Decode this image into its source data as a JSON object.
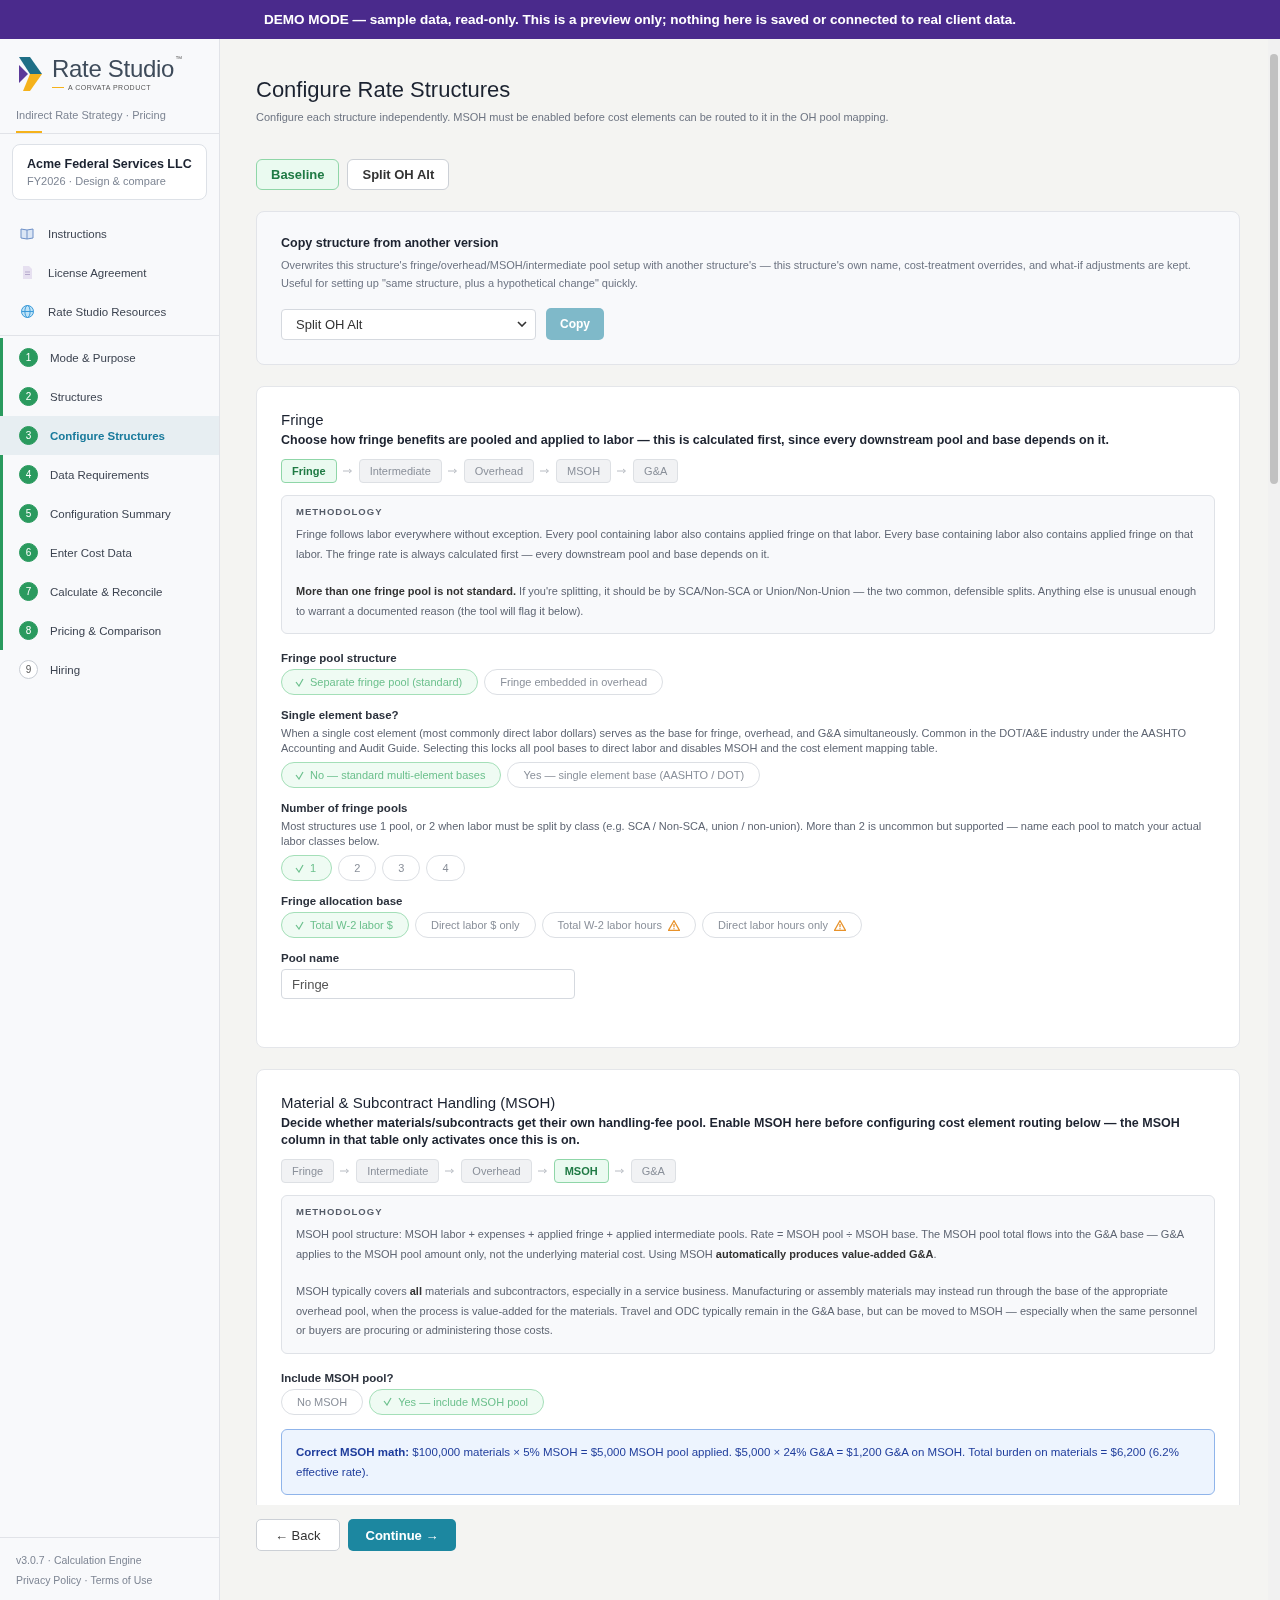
{
  "banner": {
    "text": "DEMO MODE — sample data, read-only. This is a preview only; nothing here is saved or connected to real client data."
  },
  "sidebar": {
    "logo": {
      "name": "Rate Studio",
      "trademark": "™",
      "tagline": "A CORVATA PRODUCT"
    },
    "subtitle": "Indirect Rate Strategy · Pricing",
    "client": {
      "name": "Acme Federal Services LLC",
      "detail": "FY2026 · Design & compare"
    },
    "links": [
      {
        "kind": "book",
        "label": "Instructions"
      },
      {
        "kind": "document",
        "label": "License Agreement"
      },
      {
        "kind": "globe",
        "label": "Rate Studio Resources"
      }
    ],
    "steps": [
      {
        "number": "1",
        "label": "Mode & Purpose",
        "completed": true,
        "selected": false
      },
      {
        "number": "2",
        "label": "Structures",
        "completed": true,
        "selected": false
      },
      {
        "number": "3",
        "label": "Configure Structures",
        "completed": true,
        "selected": true
      },
      {
        "number": "4",
        "label": "Data Requirements",
        "completed": true,
        "selected": false
      },
      {
        "number": "5",
        "label": "Configuration Summary",
        "completed": true,
        "selected": false
      },
      {
        "number": "6",
        "label": "Enter Cost Data",
        "completed": true,
        "selected": false
      },
      {
        "number": "7",
        "label": "Calculate & Reconcile",
        "completed": true,
        "selected": false
      },
      {
        "number": "8",
        "label": "Pricing & Comparison",
        "completed": true,
        "selected": false
      },
      {
        "number": "9",
        "label": "Hiring",
        "completed": false,
        "selected": false
      }
    ],
    "footer": {
      "version": "v3.0.7 · Calculation Engine",
      "links": [
        "Privacy Policy · Terms of Use"
      ]
    }
  },
  "page": {
    "title": "Configure Rate Structures",
    "subtitle": "Configure each structure independently. MSOH must be enabled before cost elements can be routed to it in the OH pool mapping."
  },
  "structure_tabs": [
    {
      "label": "Baseline",
      "selected": true
    },
    {
      "label": "Split OH Alt",
      "selected": false
    }
  ],
  "copy_panel": {
    "title": "Copy structure from another version",
    "description": "Overwrites this structure's fringe/overhead/MSOH/intermediate pool setup with another structure's — this structure's own name, cost-treatment overrides, and what-if adjustments are kept. Useful for setting up \"same structure, plus a hypothetical change\" quickly.",
    "select_value": "Split OH Alt",
    "button": "Copy"
  },
  "sections": [
    {
      "title": "Fringe",
      "lead": "Choose how fringe benefits are pooled and applied to labor — this is calculated first, since every downstream pool and base depends on it.",
      "pipeline": [
        {
          "label": "Fringe",
          "selected": true
        },
        {
          "label": "Intermediate",
          "selected": false
        },
        {
          "label": "Overhead",
          "selected": false
        },
        {
          "label": "MSOH",
          "selected": false
        },
        {
          "label": "G&A",
          "selected": false
        }
      ],
      "methodology": {
        "heading": "METHODOLOGY",
        "paragraphs": [
          "Fringe follows labor everywhere without exception. Every pool containing labor also contains applied fringe on that labor. Every base containing labor also contains applied fringe on that labor. The fringe rate is always calculated first — every downstream pool and base depends on it.",
          "**More than one fringe pool is not standard.** If you're splitting, it should be by SCA/Non-SCA or Union/Non-Union — the two common, defensible splits. Anything else is unusual enough to warrant a documented reason (the tool will flag it below)."
        ]
      },
      "fields": [
        {
          "kind": "options",
          "label": "Fringe pool structure",
          "options": [
            {
              "label": "Separate fringe pool (standard)",
              "selected": true,
              "warning": false
            },
            {
              "label": "Fringe embedded in overhead",
              "selected": false,
              "warning": false
            }
          ]
        },
        {
          "kind": "options",
          "label": "Single element base?",
          "help": "When a single cost element (most commonly direct labor dollars) serves as the base for fringe, overhead, and G&A simultaneously. Common in the DOT/A&E industry under the AASHTO Accounting and Audit Guide. Selecting this locks all pool bases to direct labor and disables MSOH and the cost element mapping table.",
          "options": [
            {
              "label": "No — standard multi-element bases",
              "selected": true,
              "warning": false
            },
            {
              "label": "Yes — single element base (AASHTO / DOT)",
              "selected": false,
              "warning": false
            }
          ]
        },
        {
          "kind": "options",
          "label": "Number of fringe pools",
          "help": "Most structures use 1 pool, or 2 when labor must be split by class (e.g. SCA / Non-SCA, union / non-union). More than 2 is uncommon but supported — name each pool to match your actual labor classes below.",
          "options": [
            {
              "label": "1",
              "selected": true,
              "warning": false
            },
            {
              "label": "2",
              "selected": false,
              "warning": false
            },
            {
              "label": "3",
              "selected": false,
              "warning": false
            },
            {
              "label": "4",
              "selected": false,
              "warning": false
            }
          ]
        },
        {
          "kind": "options",
          "label": "Fringe allocation base",
          "options": [
            {
              "label": "Total W-2 labor $",
              "selected": true,
              "warning": false
            },
            {
              "label": "Direct labor $ only",
              "selected": false,
              "warning": false
            },
            {
              "label": "Total W-2 labor hours",
              "selected": false,
              "warning": true
            },
            {
              "label": "Direct labor hours only",
              "selected": false,
              "warning": true
            }
          ]
        },
        {
          "kind": "text",
          "label": "Pool name",
          "value": "Fringe"
        }
      ]
    },
    {
      "title": "Material & Subcontract Handling (MSOH)",
      "lead": "Decide whether materials/subcontracts get their own handling-fee pool. Enable MSOH here **before** configuring cost element routing below — the MSOH column in that table only activates once this is on.",
      "pipeline": [
        {
          "label": "Fringe",
          "selected": false
        },
        {
          "label": "Intermediate",
          "selected": false
        },
        {
          "label": "Overhead",
          "selected": false
        },
        {
          "label": "MSOH",
          "selected": true
        },
        {
          "label": "G&A",
          "selected": false
        }
      ],
      "methodology": {
        "heading": "METHODOLOGY",
        "paragraphs": [
          "MSOH pool structure: MSOH labor + expenses + applied fringe + applied intermediate pools. Rate = MSOH pool ÷ MSOH base. The MSOH pool total flows into the G&A base — G&A applies to the MSOH pool amount only, not the underlying material cost. Using MSOH **automatically produces value-added G&A**.",
          "MSOH typically covers **all** materials and subcontractors, especially in a service business. Manufacturing or assembly materials may instead run through the base of the appropriate overhead pool, when the process is value-added for the materials. Travel and ODC typically remain in the G&A base, but can be moved to MSOH — especially when the same personnel or buyers are procuring or administering those costs."
        ]
      },
      "fields": [
        {
          "kind": "options",
          "label": "Include MSOH pool?",
          "options": [
            {
              "label": "No MSOH",
              "selected": false,
              "warning": false
            },
            {
              "label": "Yes — include MSOH pool",
              "selected": true,
              "warning": false
            }
          ]
        },
        {
          "kind": "note",
          "text": "**Correct MSOH math:** $100,000 materials × 5% MSOH = $5,000 MSOH pool applied. $5,000 × 24% G&A = $1,200 G&A on MSOH. Total burden on materials = $6,200 (6.2% effective rate)."
        }
      ]
    }
  ],
  "footer_buttons": [
    {
      "kind": "secondary",
      "label": "← Back"
    },
    {
      "kind": "primary",
      "label": "Continue →"
    }
  ]
}
